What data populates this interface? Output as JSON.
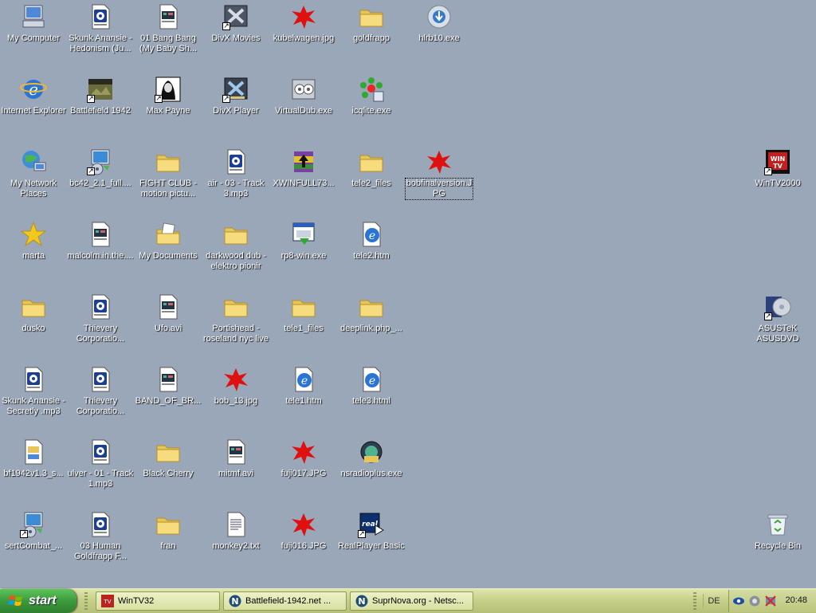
{
  "desktop": {
    "icons": [
      {
        "label": "My Computer",
        "icon": "my-computer-icon"
      },
      {
        "label": "Skunk Anansie - Hedonism (Ju...",
        "icon": "media-file-icon"
      },
      {
        "label": "01 Bang Bang (My Baby Sh...",
        "icon": "video-file-icon"
      },
      {
        "label": "DivX Movies",
        "icon": "divx-icon"
      },
      {
        "label": "kubelwagen.jpg",
        "icon": "jpeg-image-icon"
      },
      {
        "label": "goldfrapp",
        "icon": "folder-icon"
      },
      {
        "label": "hlrb10.exe",
        "icon": "installer-icon"
      },
      {
        "label": "Internet Explorer",
        "icon": "internet-explorer-icon"
      },
      {
        "label": "Battlefield 1942",
        "icon": "battlefield-icon"
      },
      {
        "label": "Max Payne",
        "icon": "max-payne-icon"
      },
      {
        "label": "DivX Player",
        "icon": "divx-player-icon"
      },
      {
        "label": "VirtualDub.exe",
        "icon": "virtualdub-icon"
      },
      {
        "label": "icqlite.exe",
        "icon": "icq-icon"
      },
      {
        "label": "My Network Places",
        "icon": "network-places-icon"
      },
      {
        "label": "bc42_2.1_full....",
        "icon": "setup-icon"
      },
      {
        "label": "FIGHT CLUB - motion pictu...",
        "icon": "folder-icon"
      },
      {
        "label": "air - 03 - Track 3.mp3",
        "icon": "media-file-icon"
      },
      {
        "label": "XWINFULL73...",
        "icon": "winrar-icon"
      },
      {
        "label": "tele2_files",
        "icon": "folder-icon"
      },
      {
        "label": "bobfinalversion.JPG",
        "icon": "jpeg-image-icon"
      },
      {
        "label": "WinTV2000",
        "icon": "wintv-icon"
      },
      {
        "label": "marta",
        "icon": "star-icon"
      },
      {
        "label": "malcolm.in.the....",
        "icon": "video-file-icon"
      },
      {
        "label": "My Documents",
        "icon": "my-documents-icon"
      },
      {
        "label": "darkwood dub - elektro pionir",
        "icon": "folder-icon"
      },
      {
        "label": "rp8-win.exe",
        "icon": "installer-window-icon"
      },
      {
        "label": "tele2.htm",
        "icon": "html-file-icon"
      },
      {
        "label": "dusko",
        "icon": "folder-icon"
      },
      {
        "label": "Thievery Corporatio...",
        "icon": "media-file-icon"
      },
      {
        "label": "Ufo.avi",
        "icon": "video-file-icon"
      },
      {
        "label": "Portishead - roseland nyc live",
        "icon": "folder-icon"
      },
      {
        "label": "tele1_files",
        "icon": "folder-icon"
      },
      {
        "label": "deeplink.php_...",
        "icon": "folder-icon"
      },
      {
        "label": "ASUSTeK ASUSDVD",
        "icon": "dvd-icon"
      },
      {
        "label": "Skunk Anansie - Secretly .mp3",
        "icon": "media-file-icon"
      },
      {
        "label": "Thievery Corporatio...",
        "icon": "media-file-icon"
      },
      {
        "label": "BAND_OF_BR...",
        "icon": "video-file-icon"
      },
      {
        "label": "bob_13.jpg",
        "icon": "jpeg-image-icon"
      },
      {
        "label": "tele1.htm",
        "icon": "html-file-icon"
      },
      {
        "label": "tele3.html",
        "icon": "html-file-icon"
      },
      {
        "label": "bf1942v1.3_s...",
        "icon": "patch-icon"
      },
      {
        "label": "ulver - 01 - Track 1.mp3",
        "icon": "media-file-icon"
      },
      {
        "label": "Black Cherry",
        "icon": "folder-icon"
      },
      {
        "label": "mitmf.avi",
        "icon": "video-file-icon"
      },
      {
        "label": "fuji017.JPG",
        "icon": "jpeg-image-icon"
      },
      {
        "label": "nsradioplus.exe",
        "icon": "radio-icon"
      },
      {
        "label": "sertCombat_...",
        "icon": "setup-icon"
      },
      {
        "label": "03 Human Goldfrapp F...",
        "icon": "media-file-icon"
      },
      {
        "label": "fran",
        "icon": "folder-icon"
      },
      {
        "label": "monkey2.txt",
        "icon": "text-file-icon"
      },
      {
        "label": "fuji016.JPG",
        "icon": "jpeg-image-icon"
      },
      {
        "label": "RealPlayer Basic",
        "icon": "realplayer-icon"
      },
      {
        "label": "Recycle Bin",
        "icon": "recycle-bin-icon"
      }
    ]
  },
  "taskbar": {
    "start_label": "start",
    "tasks": [
      {
        "label": "WinTV32",
        "icon": "wintv-icon"
      },
      {
        "label": "Battlefield-1942.net ...",
        "icon": "netscape-icon"
      },
      {
        "label": "SuprNova.org - Netsc...",
        "icon": "netscape-icon"
      }
    ],
    "language": "DE",
    "clock": "20:48"
  }
}
